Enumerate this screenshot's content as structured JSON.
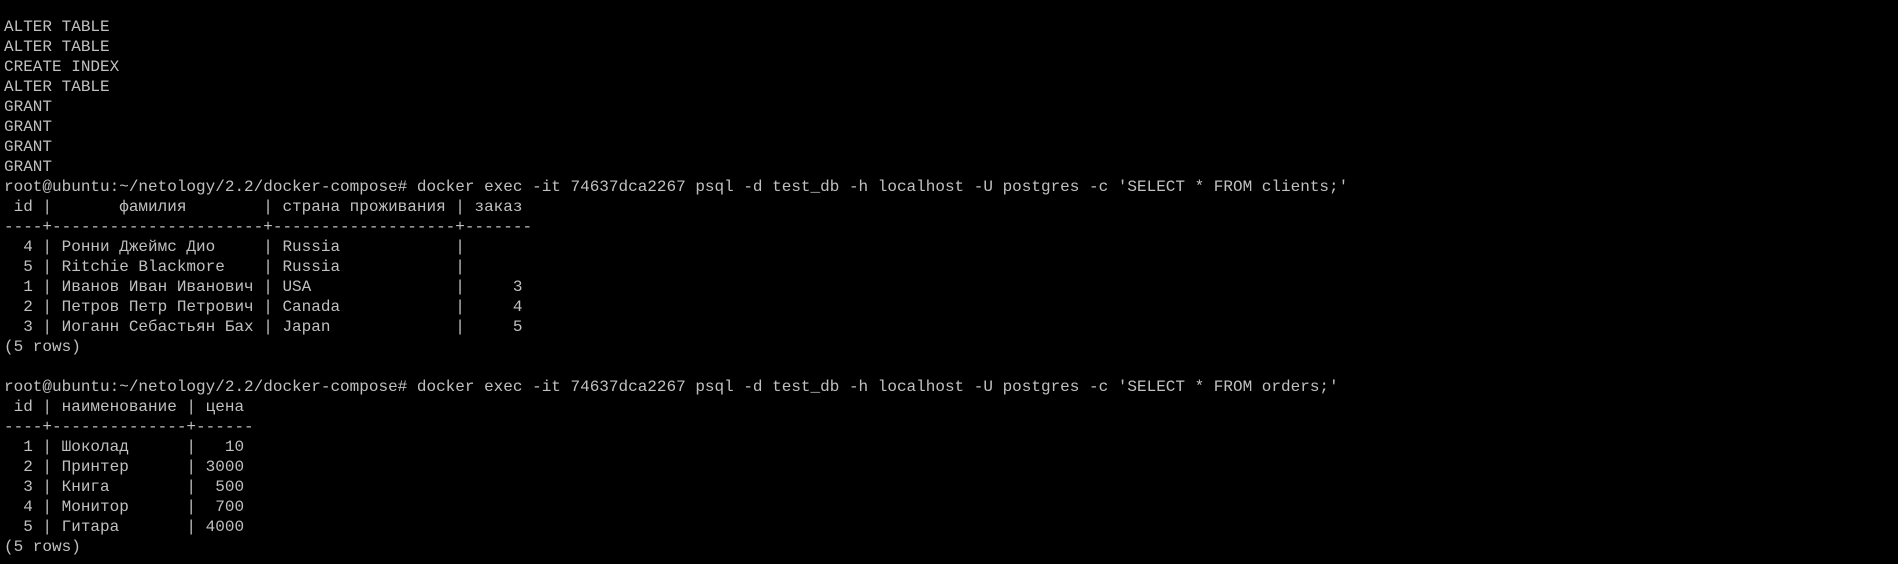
{
  "terminal": {
    "lines": [
      "",
      "ALTER TABLE",
      "ALTER TABLE",
      "CREATE INDEX",
      "ALTER TABLE",
      "GRANT",
      "GRANT",
      "GRANT",
      "GRANT",
      "root@ubuntu:~/netology/2.2/docker-compose# docker exec -it 74637dca2267 psql -d test_db -h localhost -U postgres -c 'SELECT * FROM clients;'",
      " id |       фамилия        | страна проживания | заказ",
      "----+----------------------+-------------------+-------",
      "  4 | Ронни Джеймс Дио     | Russia            |",
      "  5 | Ritchie Blackmore    | Russia            |",
      "  1 | Иванов Иван Иванович | USA               |     3",
      "  2 | Петров Петр Петрович | Canada            |     4",
      "  3 | Иоганн Себастьян Бах | Japan             |     5",
      "(5 rows)",
      "",
      "root@ubuntu:~/netology/2.2/docker-compose# docker exec -it 74637dca2267 psql -d test_db -h localhost -U postgres -c 'SELECT * FROM orders;'",
      " id | наименование | цена",
      "----+--------------+------",
      "  1 | Шоколад      |   10",
      "  2 | Принтер      | 3000",
      "  3 | Книга        |  500",
      "  4 | Монитор      |  700",
      "  5 | Гитара       | 4000",
      "(5 rows)"
    ]
  }
}
